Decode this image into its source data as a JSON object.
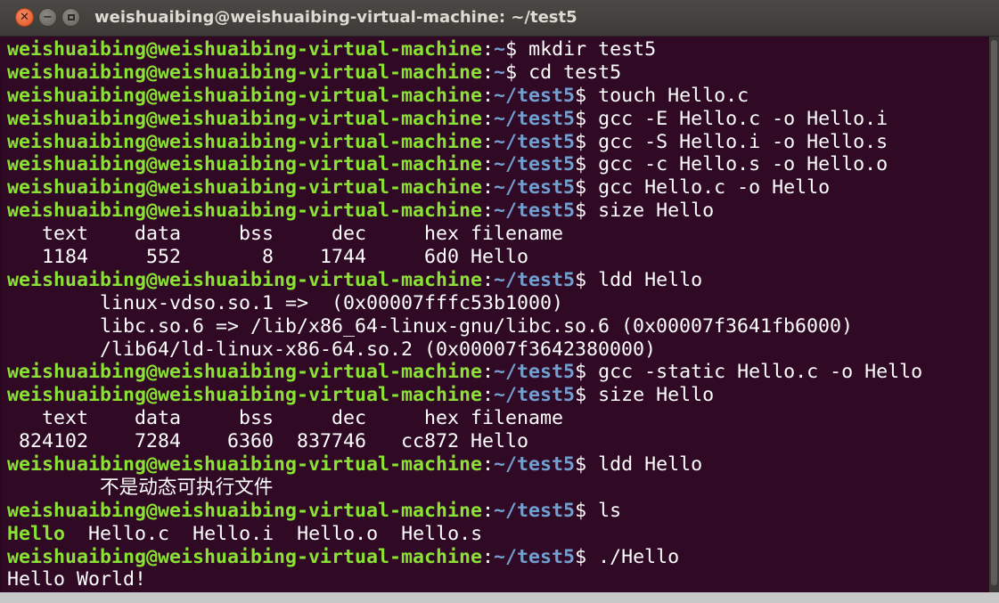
{
  "window": {
    "title": "weishuaibing@weishuaibing-virtual-machine: ~/test5",
    "close_glyph": "✕",
    "min_glyph": "−",
    "max_glyph": ""
  },
  "colors": {
    "background": "#300a24",
    "prompt_user": "#8ae234",
    "prompt_path": "#729fcf",
    "text": "#ffffff"
  },
  "icons": {
    "close": "close-icon",
    "minimize": "minimize-icon",
    "maximize": "maximize-icon"
  },
  "prompt_user": "weishuaibing@weishuaibing-virtual-machine",
  "lines": [
    {
      "type": "prompt",
      "path": "~",
      "cmd": "mkdir test5"
    },
    {
      "type": "prompt",
      "path": "~",
      "cmd": "cd test5"
    },
    {
      "type": "prompt",
      "path": "~/test5",
      "cmd": "touch Hello.c"
    },
    {
      "type": "prompt",
      "path": "~/test5",
      "cmd": "gcc -E Hello.c -o Hello.i"
    },
    {
      "type": "prompt",
      "path": "~/test5",
      "cmd": "gcc -S Hello.i -o Hello.s"
    },
    {
      "type": "prompt",
      "path": "~/test5",
      "cmd": "gcc -c Hello.s -o Hello.o"
    },
    {
      "type": "prompt",
      "path": "~/test5",
      "cmd": "gcc Hello.c -o Hello"
    },
    {
      "type": "prompt",
      "path": "~/test5",
      "cmd": "size Hello"
    },
    {
      "type": "output",
      "text": "   text\t   data\t    bss\t    dec\t    hex\tfilename"
    },
    {
      "type": "output",
      "text": "   1184\t    552\t      8\t   1744\t    6d0\tHello"
    },
    {
      "type": "prompt",
      "path": "~/test5",
      "cmd": "ldd Hello"
    },
    {
      "type": "output",
      "text": "\tlinux-vdso.so.1 =>  (0x00007fffc53b1000)"
    },
    {
      "type": "output",
      "text": "\tlibc.so.6 => /lib/x86_64-linux-gnu/libc.so.6 (0x00007f3641fb6000)"
    },
    {
      "type": "output",
      "text": "\t/lib64/ld-linux-x86-64.so.2 (0x00007f3642380000)"
    },
    {
      "type": "prompt",
      "path": "~/test5",
      "cmd": "gcc -static Hello.c -o Hello"
    },
    {
      "type": "prompt",
      "path": "~/test5",
      "cmd": "size Hello"
    },
    {
      "type": "output",
      "text": "   text\t   data\t    bss\t    dec\t    hex\tfilename"
    },
    {
      "type": "output",
      "text": " 824102\t   7284\t   6360\t 837746\t  cc872\tHello"
    },
    {
      "type": "prompt",
      "path": "~/test5",
      "cmd": "ldd Hello"
    },
    {
      "type": "output",
      "cjk": true,
      "text": "\t不是动态可执行文件"
    },
    {
      "type": "prompt",
      "path": "~/test5",
      "cmd": "ls"
    },
    {
      "type": "ls",
      "items": [
        {
          "name": "Hello",
          "exec": true
        },
        {
          "name": "Hello.c",
          "exec": false
        },
        {
          "name": "Hello.i",
          "exec": false
        },
        {
          "name": "Hello.o",
          "exec": false
        },
        {
          "name": "Hello.s",
          "exec": false
        }
      ]
    },
    {
      "type": "prompt",
      "path": "~/test5",
      "cmd": "./Hello"
    },
    {
      "type": "output",
      "text": "Hello World!"
    }
  ]
}
